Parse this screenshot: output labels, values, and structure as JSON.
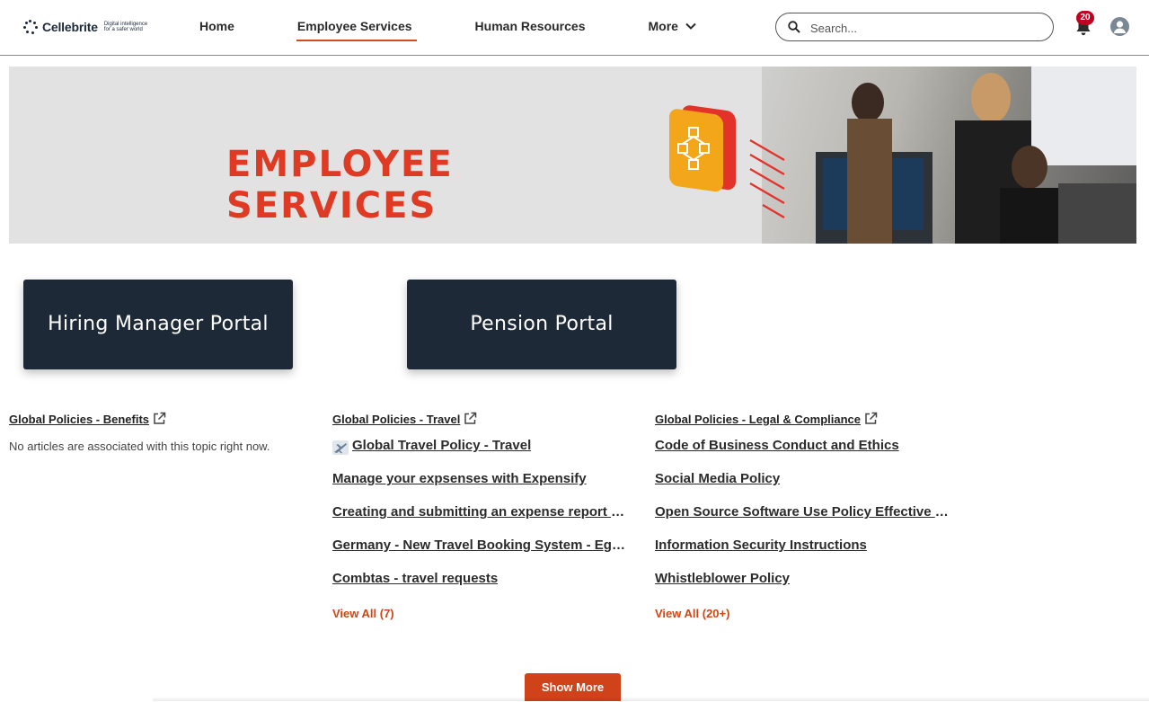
{
  "header": {
    "logo": {
      "name": "Cellebrite",
      "tagline": "Digital intelligence for a safer world"
    },
    "nav": [
      {
        "label": "Home",
        "active": false
      },
      {
        "label": "Employee Services",
        "active": true
      },
      {
        "label": "Human Resources",
        "active": false
      },
      {
        "label": "More",
        "active": false,
        "has_dropdown": true
      }
    ],
    "search": {
      "placeholder": "Search..."
    },
    "notifications": {
      "count": "20",
      "icon": "bell-icon"
    },
    "avatar_icon": "user-avatar-icon",
    "accent_color": "#d64a1e"
  },
  "banner": {
    "title_line1": "EMPLOYEE",
    "title_line2": "SERVICES",
    "title_color": "#de3a24"
  },
  "portals": [
    {
      "label": "Hiring Manager Portal"
    },
    {
      "label": "Pension Portal"
    }
  ],
  "columns": [
    {
      "heading": "Global Policies - Benefits",
      "empty_message": "No articles are associated with this topic right now.",
      "links": []
    },
    {
      "heading": "Global Policies - Travel",
      "links": [
        "Global Travel Policy - Travel",
        "Manage your expsenses with Expensify",
        "Creating and submitting an expense report o...",
        "Germany - New Travel Booking System - Ege...",
        "Combtas - travel requests"
      ],
      "view_all": "View All (7)"
    },
    {
      "heading": "Global Policies - Legal & Compliance",
      "links": [
        "Code of Business Conduct and Ethics",
        "Social Media Policy",
        "Open Source Software Use Policy Effective D...",
        "Information Security Instructions",
        "Whistleblower Policy"
      ],
      "view_all": "View All (20+)"
    }
  ],
  "show_more": "Show More",
  "colors": {
    "tile_bg": "#1e2937",
    "link_accent": "#d14512",
    "button_bg": "#d0421a",
    "badge": "#c1001f"
  }
}
